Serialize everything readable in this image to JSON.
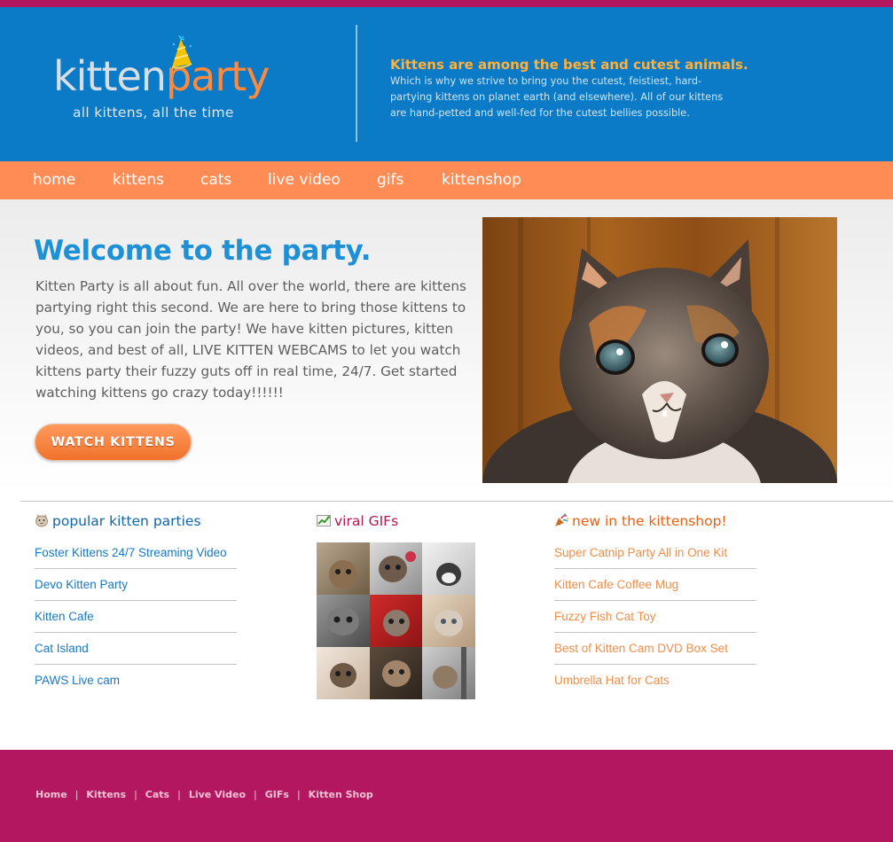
{
  "brand": {
    "logo_kitten": "kitten",
    "logo_party": "party",
    "tagline": "all kittens, all the time",
    "colors": {
      "header_blue": "#0b7bc7",
      "nav_orange": "#ff8c55",
      "footer_magenta": "#b3175f",
      "accent_orange": "#ff8a3d"
    }
  },
  "header": {
    "heading": "Kittens are among the best and cutest animals.",
    "body": "Which is why we strive to bring you the cutest, feistiest, hard-partying kittens on planet earth (and elsewhere). All of our kittens are hand-petted and well-fed for the cutest bellies possible."
  },
  "nav": {
    "items": [
      {
        "label": "home"
      },
      {
        "label": "kittens"
      },
      {
        "label": "cats"
      },
      {
        "label": "live video"
      },
      {
        "label": "gifs"
      },
      {
        "label": "kittenshop"
      }
    ]
  },
  "hero": {
    "title": "Welcome to the party.",
    "text": "Kitten Party is all about fun. All over the world, there are kittens partying right this second. We are here to bring those kittens to you, so you can join the party! We have kitten pictures, kitten videos, and best of all, LIVE KITTEN WEBCAMS to let you watch kittens party their fuzzy guts off in real time, 24/7. Get started watching kittens go crazy today!!!!!!",
    "button_label": "WATCH KITTENS",
    "image_icon": "kitten-photo"
  },
  "popular": {
    "heading": "popular kitten parties",
    "icon": "cat-face-icon",
    "links": [
      "Foster Kittens 24/7 Streaming Video",
      "Devo Kitten Party",
      "Kitten Cafe",
      "Cat Island",
      "PAWS Live cam"
    ]
  },
  "gifs": {
    "heading": "viral GIFs",
    "icon": "chart-up-icon"
  },
  "shop": {
    "heading": "new in the kittenshop!",
    "icon": "party-popper-icon",
    "links": [
      "Super Catnip Party All in One Kit",
      "Kitten Cafe Coffee Mug",
      "Fuzzy Fish Cat Toy",
      "Best of Kitten Cam DVD Box Set",
      "Umbrella Hat for Cats"
    ]
  },
  "footer": {
    "links": [
      "Home",
      "Kittens",
      "Cats",
      "Live Video",
      "GIFs",
      "Kitten Shop"
    ],
    "separator": "|"
  }
}
